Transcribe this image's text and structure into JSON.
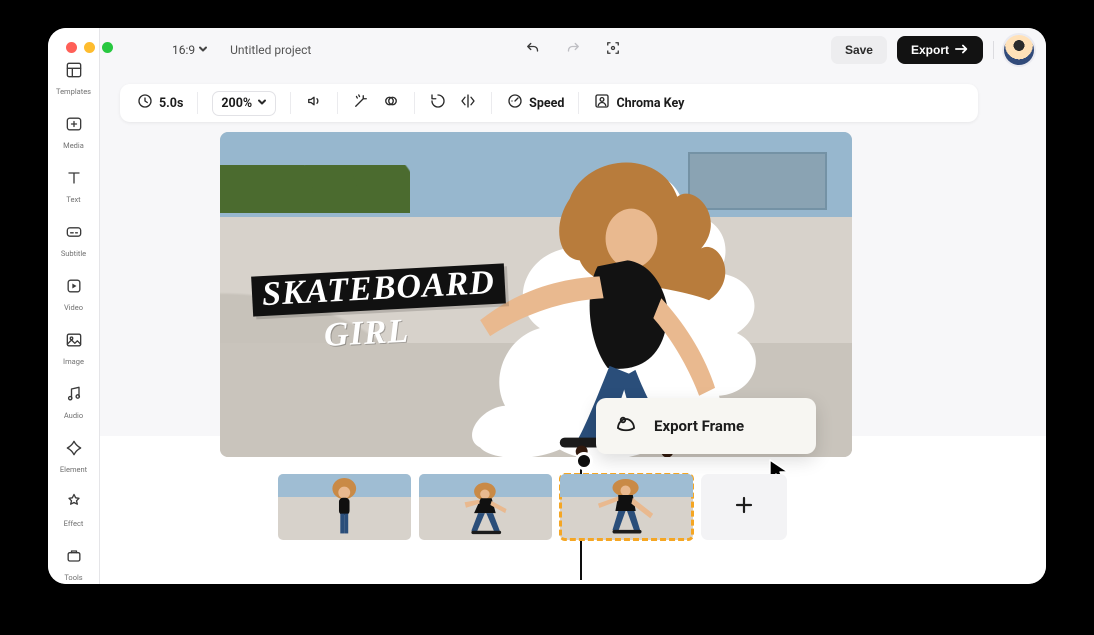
{
  "colors": {
    "accent_orange": "#f5a623",
    "export_bg": "#121212"
  },
  "header": {
    "ratio": "16:9",
    "project_title": "Untitled project",
    "save_label": "Save",
    "export_label": "Export"
  },
  "sidebar": {
    "items": [
      {
        "key": "templates-icon",
        "label": "Templates"
      },
      {
        "key": "media-icon",
        "label": "Media"
      },
      {
        "key": "text-icon",
        "label": "Text"
      },
      {
        "key": "subtitle-icon",
        "label": "Subtitle"
      },
      {
        "key": "video-icon",
        "label": "Video"
      },
      {
        "key": "image-icon",
        "label": "Image"
      },
      {
        "key": "audio-icon",
        "label": "Audio"
      },
      {
        "key": "element-icon",
        "label": "Element"
      },
      {
        "key": "effect-icon",
        "label": "Effect"
      },
      {
        "key": "tools-icon",
        "label": "Tools"
      }
    ]
  },
  "toolbar": {
    "duration": "5.0s",
    "zoom": "200%",
    "speed_label": "Speed",
    "chroma_label": "Chroma Key"
  },
  "canvas": {
    "title_line1": "SKATEBOARD",
    "title_line2": "GIRL"
  },
  "context_menu": {
    "export_frame": "Export Frame"
  },
  "timeline": {
    "clips": [
      {
        "id": "clip-1",
        "selected": false
      },
      {
        "id": "clip-2",
        "selected": false
      },
      {
        "id": "clip-3",
        "selected": true
      }
    ]
  }
}
